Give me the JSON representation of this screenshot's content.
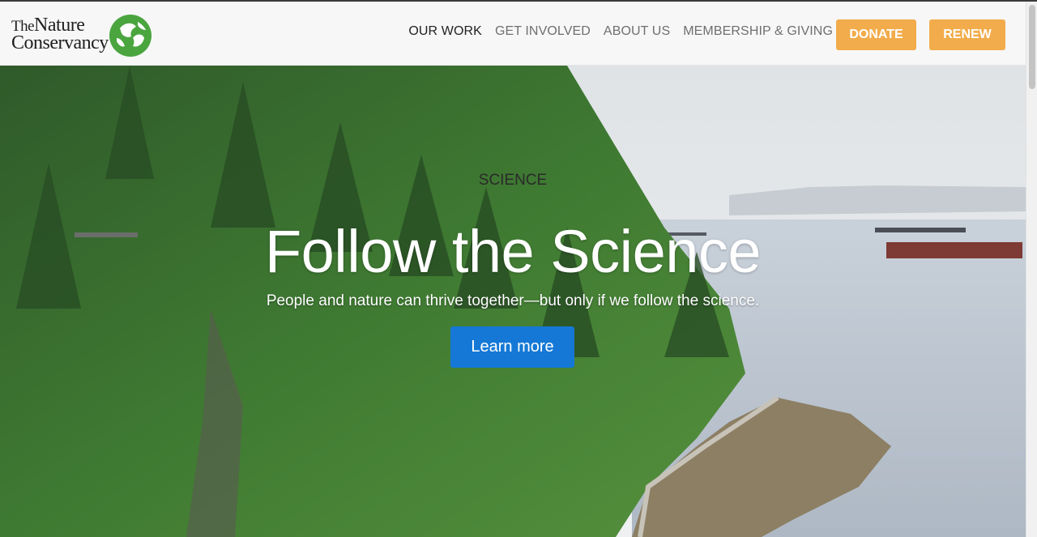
{
  "brand": {
    "line1_the": "The",
    "line1_rest": "Nature",
    "line2": "Conservancy",
    "logo_icon": "globe-leaf-icon",
    "logo_color": "#4aa53f"
  },
  "nav": {
    "items": [
      {
        "label": "OUR WORK",
        "active": true
      },
      {
        "label": "GET INVOLVED",
        "active": false
      },
      {
        "label": "ABOUT US",
        "active": false
      },
      {
        "label": "MEMBERSHIP & GIVING",
        "active": false
      }
    ],
    "donate_label": "DONATE",
    "renew_label": "RENEW",
    "button_color": "#f2ac4b"
  },
  "hero": {
    "eyebrow": "SCIENCE",
    "headline": "Follow the Science",
    "subheadline": "People and nature can thrive together—but only if we follow the science.",
    "cta_label": "Learn more",
    "cta_color": "#1578d6"
  }
}
